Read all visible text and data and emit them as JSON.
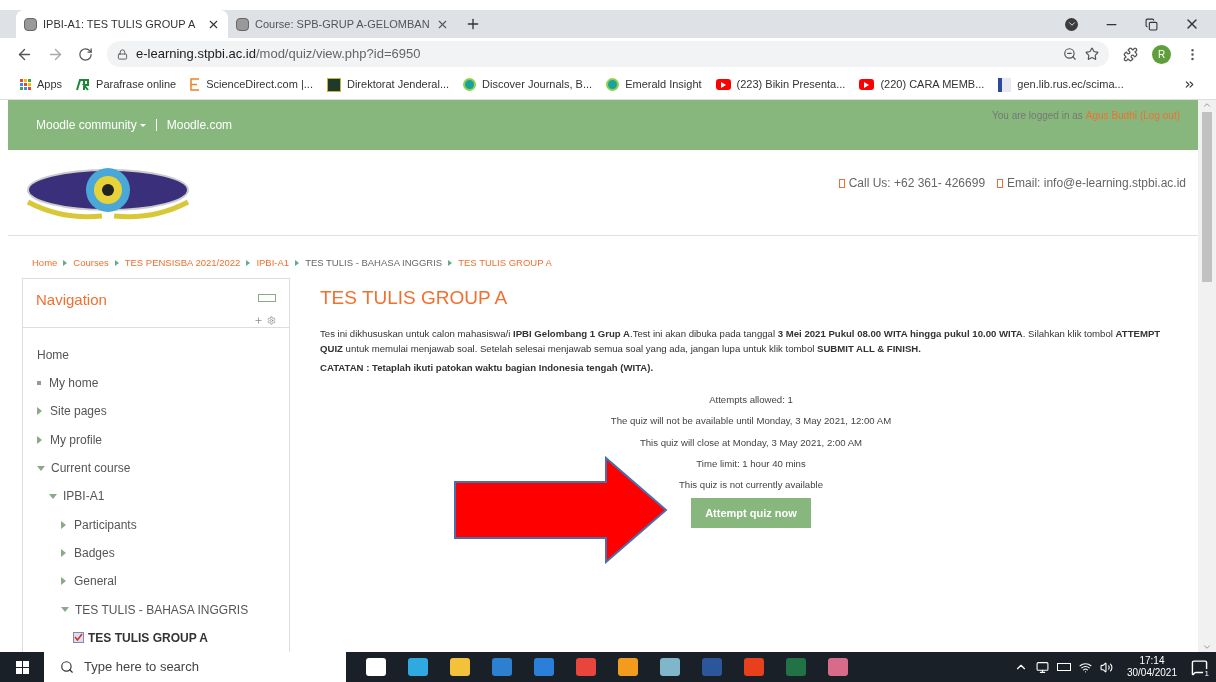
{
  "browser": {
    "tabs": [
      {
        "title": "IPBI-A1: TES TULIS GROUP A",
        "selected": true
      },
      {
        "title": "Course: SPB-GRUP A-GELOMBAN",
        "selected": false
      }
    ],
    "address": {
      "domain": "e-learning.stpbi.ac.id",
      "path": "/mod/quiz/view.php?id=6950"
    },
    "profile_initial": "R",
    "apps_label": "Apps",
    "bookmarks": [
      {
        "label": "Parafrase online",
        "kind": "pr"
      },
      {
        "label": "ScienceDirect.com |...",
        "kind": "e"
      },
      {
        "label": "Direktorat Jenderal...",
        "kind": "gov"
      },
      {
        "label": "Discover Journals, B...",
        "kind": "emerald"
      },
      {
        "label": "Emerald Insight",
        "kind": "emerald"
      },
      {
        "label": "(223) Bikin Presenta...",
        "kind": "youtube"
      },
      {
        "label": "(220) CARA MEMB...",
        "kind": "youtube"
      },
      {
        "label": "gen.lib.rus.ec/scima...",
        "kind": "lib"
      }
    ]
  },
  "header": {
    "nav_links": [
      {
        "label": "Moodle community",
        "dropdown": true
      },
      {
        "label": "Moodle.com",
        "dropdown": false
      }
    ],
    "login": {
      "prefix": "You are logged in as",
      "user": "Agus Budhi",
      "logout": "(Log out)"
    },
    "contacts": [
      "Call Us: +62 361- 426699",
      "Email: info@e-learning.stpbi.ac.id"
    ]
  },
  "breadcrumb": [
    {
      "label": "Home",
      "link": true
    },
    {
      "label": "Courses",
      "link": true
    },
    {
      "label": "TES PENSISBA 2021/2022",
      "link": true
    },
    {
      "label": "IPBI-A1",
      "link": true
    },
    {
      "label": "TES TULIS - BAHASA INGGRIS",
      "link": false
    },
    {
      "label": "TES TULIS GROUP A",
      "link": true
    }
  ],
  "navigation": {
    "title": "Navigation",
    "items": [
      {
        "label": "Home",
        "kind": "plain"
      },
      {
        "label": "My home",
        "kind": "leaf"
      },
      {
        "label": "Site pages",
        "kind": "branch",
        "expanded": false
      },
      {
        "label": "My profile",
        "kind": "branch",
        "expanded": false
      },
      {
        "label": "Current course",
        "kind": "branch",
        "expanded": true,
        "children": [
          {
            "label": "IPBI-A1",
            "kind": "branch",
            "expanded": true,
            "children": [
              {
                "label": "Participants",
                "kind": "branch",
                "expanded": false
              },
              {
                "label": "Badges",
                "kind": "branch",
                "expanded": false
              },
              {
                "label": "General",
                "kind": "branch",
                "expanded": false
              },
              {
                "label": "TES TULIS - BAHASA INGGRIS",
                "kind": "branch",
                "expanded": true,
                "children": [
                  {
                    "label": "TES TULIS GROUP A",
                    "kind": "quiz",
                    "selected": true
                  }
                ]
              }
            ]
          }
        ]
      }
    ]
  },
  "quiz": {
    "title": "TES TULIS GROUP A",
    "intro": "Tes ini dikhususkan untuk calon mahasiswa/i **IPBI Gelombang 1 Grup A**.Test ini akan dibuka pada tanggal **3 Mei 2021 Pukul 08.00 WITA hingga pukul 10.00 WITA**. Silahkan klik tombol **ATTEMPT QUIZ** untuk memulai menjawab soal. Setelah selesai menjawab semua soal yang ada, jangan lupa untuk klik tombol **SUBMIT ALL & FINISH.**",
    "note": "CATATAN :  Tetaplah ikuti patokan waktu bagian Indonesia tengah (WITA).",
    "info": [
      "Attempts allowed: 1",
      "The quiz will not be available until Monday, 3 May 2021, 12:00 AM",
      "This quiz will close at Monday, 3 May 2021, 2:00 AM",
      "Time limit: 1 hour 40 mins",
      "This quiz is not currently available"
    ],
    "button": "Attempt quiz now"
  },
  "taskbar": {
    "search_placeholder": "Type here to search",
    "time": "17:14",
    "date": "30/04/2021",
    "notification_count": "1"
  }
}
